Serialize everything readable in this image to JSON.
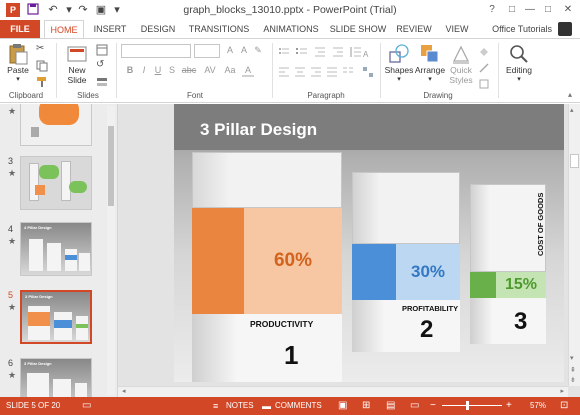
{
  "window": {
    "title": "graph_blocks_13010.pptx - PowerPoint (Trial)",
    "controls": [
      "?",
      "□",
      "—",
      "□",
      "✕"
    ]
  },
  "tabs": {
    "file": "FILE",
    "items": [
      "HOME",
      "INSERT",
      "DESIGN",
      "TRANSITIONS",
      "ANIMATIONS",
      "SLIDE SHOW",
      "REVIEW",
      "VIEW"
    ],
    "active": "HOME",
    "account": "Office Tutorials"
  },
  "ribbon": {
    "groups": {
      "clipboard": "Clipboard",
      "slides": "Slides",
      "font": "Font",
      "paragraph": "Paragraph",
      "drawing": "Drawing"
    },
    "buttons": {
      "paste": "Paste",
      "new_slide_1": "New",
      "new_slide_2": "Slide",
      "shapes": "Shapes",
      "arrange": "Arrange",
      "quick_styles_1": "Quick",
      "quick_styles_2": "Styles",
      "editing": "Editing"
    },
    "format_letters": [
      "B",
      "I",
      "U",
      "S",
      "abc",
      "AV",
      "Aa",
      "A"
    ]
  },
  "thumbnails": [
    {
      "num": "",
      "active": false,
      "kind": "orange-text"
    },
    {
      "num": "3",
      "active": false,
      "kind": "callouts"
    },
    {
      "num": "4",
      "active": false,
      "kind": "pillars",
      "label": "4 Pillar Design"
    },
    {
      "num": "5",
      "active": true,
      "kind": "pillars",
      "label": "3 Pillar Design"
    },
    {
      "num": "6",
      "active": false,
      "kind": "pillars",
      "label": "3 Pillar Design"
    }
  ],
  "slide": {
    "title": "3 Pillar Design",
    "pillars": [
      {
        "label": "PRODUCTIVITY",
        "percent": "60%",
        "number": "1",
        "color": "#f0904a",
        "pct_color": "#d2621c"
      },
      {
        "label": "PROFITABILITY",
        "percent": "30%",
        "number": "2",
        "color": "#4a8fd8",
        "pct_color": "#3378c4"
      },
      {
        "label": "COST OF GOODS",
        "percent": "15%",
        "number": "3",
        "color": "#7cc25a",
        "pct_color": "#4e9a2e"
      }
    ]
  },
  "status": {
    "slide_info": "SLIDE 5 OF 20",
    "notes": "NOTES",
    "comments": "COMMENTS",
    "zoom": "57%"
  },
  "colors": {
    "accent": "#d24726",
    "orange": "#f0904a",
    "blue": "#4a8fd8",
    "green": "#7cc25a"
  }
}
